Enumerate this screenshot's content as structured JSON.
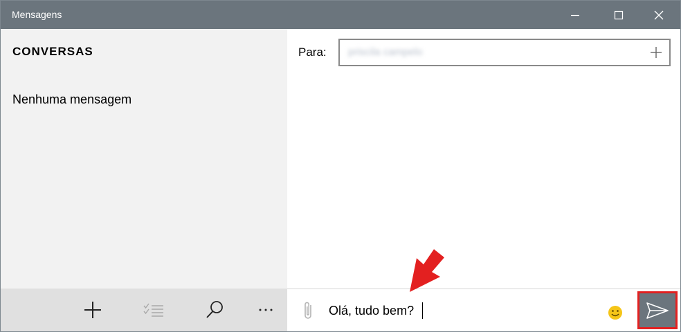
{
  "window": {
    "title": "Mensagens",
    "controls": {
      "minimize": "minimize-icon",
      "maximize": "maximize-icon",
      "close": "close-icon"
    }
  },
  "conversations": {
    "heading": "CONVERSAS",
    "empty_text": "Nenhuma mensagem",
    "toolbar": [
      {
        "icon": "plus-icon",
        "name": "new-message-button"
      },
      {
        "icon": "select-list-icon",
        "name": "select-button"
      },
      {
        "icon": "search-icon",
        "name": "search-button"
      },
      {
        "icon": "more-icon",
        "name": "more-button"
      }
    ]
  },
  "compose": {
    "to_label": "Para:",
    "recipient": "priscila campelo",
    "recipient_blurred": true,
    "add_icon": "plus-icon",
    "attach_icon": "paperclip-icon",
    "message_value": "Olá, tudo bem?",
    "emoji_icon": "smiley-icon",
    "send_icon": "send-icon"
  },
  "annotations": {
    "send_highlight_color": "#e32020",
    "arrow_color": "#e32020"
  },
  "colors": {
    "titlebar": "#6b757d",
    "left_pane": "#f2f2f2",
    "toolbar": "#e0e0e0",
    "emoji": "#f5c518"
  }
}
